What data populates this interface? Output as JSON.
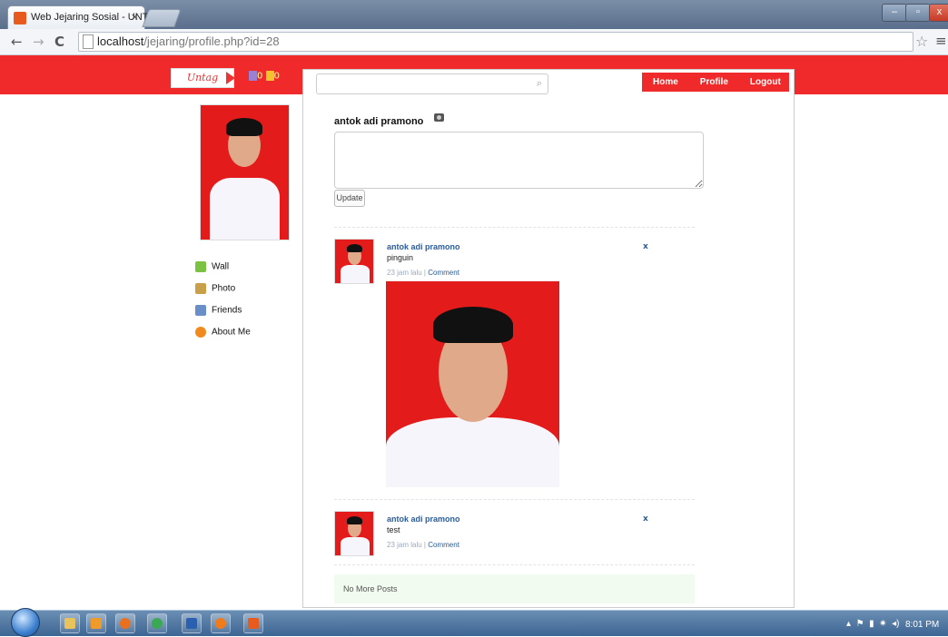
{
  "browser": {
    "tab_title": "Web Jejaring Sosial - UNT",
    "tab_close": "×",
    "url_host": "localhost",
    "url_path": "/jejaring/profile.php?id=28",
    "window_min": "–",
    "window_max": "▫",
    "window_close": "x"
  },
  "header": {
    "logo_text": "Untag",
    "notif_friends": "0",
    "notif_messages": "0",
    "search_placeholder": "",
    "nav": [
      "Home",
      "Profile",
      "Logout"
    ],
    "brand_color": "#f02a2a"
  },
  "sidebar": {
    "items": [
      {
        "label": "Wall",
        "icon": "wall-icon",
        "color": "#7cc242"
      },
      {
        "label": "Photo",
        "icon": "photo-icon",
        "color": "#c9a04a"
      },
      {
        "label": "Friends",
        "icon": "friends-icon",
        "color": "#6a8fc8"
      },
      {
        "label": "About Me",
        "icon": "about-icon",
        "color": "#f08a1e"
      }
    ]
  },
  "status": {
    "user_name": "antok adi pramono",
    "textarea_value": "",
    "update_label": "Update"
  },
  "posts": [
    {
      "author": "antok adi pramono",
      "text": "pinguin",
      "time": "23 jam lalu",
      "separator": "|",
      "comment": "Comment",
      "delete": "x",
      "has_image": true
    },
    {
      "author": "antok adi pramono",
      "text": "test",
      "time": "23 jam lalu",
      "separator": "|",
      "comment": "Comment",
      "delete": "x",
      "has_image": false
    }
  ],
  "no_more_posts": "No More Posts",
  "taskbar": {
    "clock": "8:01 PM"
  }
}
